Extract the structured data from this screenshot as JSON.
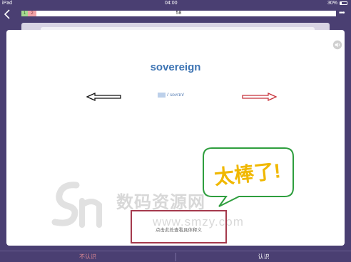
{
  "status_bar": {
    "device": "iPad",
    "time": "04:00",
    "battery": "30%"
  },
  "nav": {
    "back_icon": "chevron-left-icon",
    "progress": {
      "known_count": "1",
      "unknown_count": "2",
      "total": "58"
    },
    "more_icon": "ellipsis-icon"
  },
  "card": {
    "word": "sovereign",
    "phonetic": "/ˈsɒvrɪn/",
    "speaker_icon": "speaker-icon",
    "hint_text": "点击此处查看具体释义"
  },
  "overlay": {
    "bubble_text": "太棒了!",
    "watermark_title": "数码资源网",
    "watermark_url": "www.smzy.com"
  },
  "bottom": {
    "unknown_label": "不认识",
    "known_label": "认识"
  },
  "colors": {
    "background": "#4a3f72",
    "word": "#3d74b3",
    "unknown": "#e08a94",
    "bubble_border": "#2e9e3e",
    "bubble_text": "#f0b800",
    "hint_border": "#a53a4d"
  }
}
